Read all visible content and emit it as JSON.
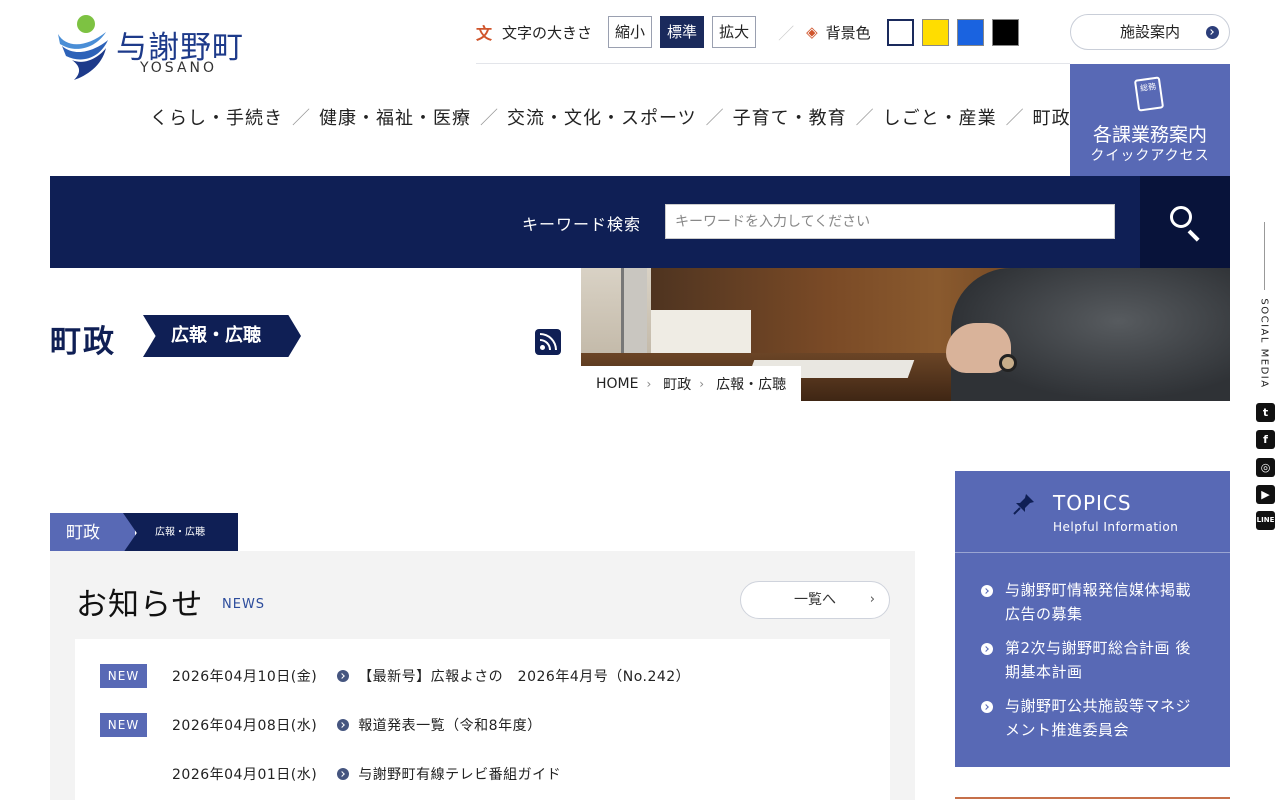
{
  "header": {
    "logo_jp": "与謝野町",
    "logo_en": "YOSANO",
    "font_size_label": "文字の大きさ",
    "font_size_options": [
      "縮小",
      "標準",
      "拡大"
    ],
    "font_size_active": "標準",
    "bg_color_label": "背景色",
    "bg_colors": [
      "#ffffff",
      "#ffdd00",
      "#1a63e0",
      "#000000"
    ],
    "facility_button": "施設案内",
    "quick_access": {
      "title": "各課業務案内",
      "subtitle": "クイックアクセス",
      "icon_text": "総務"
    }
  },
  "nav": {
    "items": [
      "くらし・手続き",
      "健康・福祉・医療",
      "交流・文化・スポーツ",
      "子育て・教育",
      "しごと・産業",
      "町政"
    ]
  },
  "search": {
    "label": "キーワード検索",
    "placeholder": "キーワードを入力してください",
    "value": ""
  },
  "page": {
    "category": "町政",
    "subcategory": "広報・広聴"
  },
  "breadcrumb": [
    "HOME",
    "町政",
    "広報・広聴"
  ],
  "social": {
    "label": "SOCIAL MEDIA",
    "icons": [
      "twitter-icon",
      "facebook-icon",
      "instagram-icon",
      "youtube-icon",
      "line-icon"
    ]
  },
  "section_tab": {
    "main": "町政",
    "sub": "広報・広聴"
  },
  "news": {
    "title": "お知らせ",
    "title_en": "NEWS",
    "list_button": "一覧へ",
    "new_badge": "NEW",
    "items": [
      {
        "new": true,
        "date": "2026年04月10日(金)",
        "title": "【最新号】広報よさの　2026年4月号（No.242）"
      },
      {
        "new": true,
        "date": "2026年04月08日(水)",
        "title": "報道発表一覧（令和8年度）"
      },
      {
        "new": false,
        "date": "2026年04月01日(水)",
        "title": "与謝野町有線テレビ番組ガイド"
      }
    ]
  },
  "topics": {
    "title": "TOPICS",
    "subtitle": "Helpful Information",
    "items": [
      "与謝野町情報発信媒体掲載広告の募集",
      "第2次与謝野町総合計画 後期基本計画",
      "与謝野町公共施設等マネジメント推進委員会"
    ]
  }
}
